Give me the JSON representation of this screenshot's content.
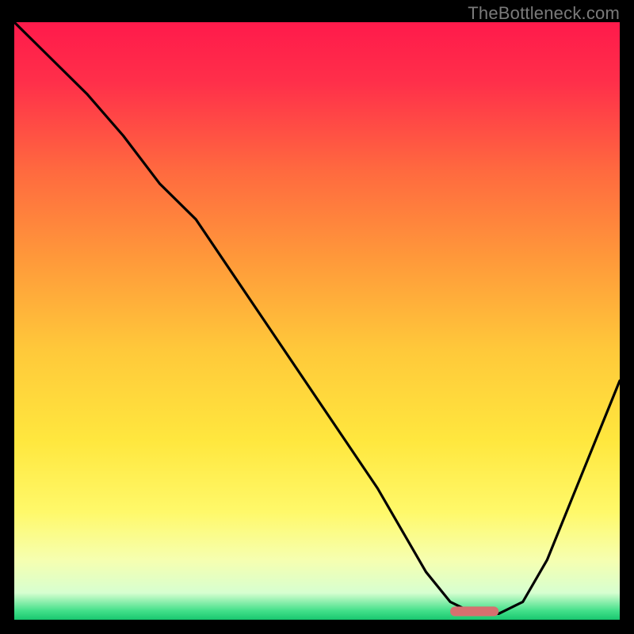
{
  "watermark": "TheBottleneck.com",
  "chart_data": {
    "type": "line",
    "title": "",
    "xlabel": "",
    "ylabel": "",
    "xlim": [
      0,
      100
    ],
    "ylim": [
      0,
      100
    ],
    "grid": false,
    "legend": false,
    "gradient_stops": [
      {
        "offset": 0.0,
        "color": "#ff1a4b"
      },
      {
        "offset": 0.1,
        "color": "#ff2f4a"
      },
      {
        "offset": 0.25,
        "color": "#ff6a3f"
      },
      {
        "offset": 0.4,
        "color": "#ff9a3a"
      },
      {
        "offset": 0.55,
        "color": "#ffc93a"
      },
      {
        "offset": 0.7,
        "color": "#ffe73e"
      },
      {
        "offset": 0.82,
        "color": "#fff96a"
      },
      {
        "offset": 0.9,
        "color": "#f6ffb0"
      },
      {
        "offset": 0.955,
        "color": "#d7ffd0"
      },
      {
        "offset": 0.985,
        "color": "#43e08a"
      },
      {
        "offset": 1.0,
        "color": "#19c76f"
      }
    ],
    "series": [
      {
        "name": "bottleneck-curve",
        "color": "#000000",
        "x": [
          0,
          6,
          12,
          18,
          24,
          30,
          36,
          42,
          48,
          54,
          60,
          64,
          68,
          72,
          76,
          80,
          84,
          88,
          92,
          96,
          100
        ],
        "values": [
          100,
          94,
          88,
          81,
          73,
          67,
          58,
          49,
          40,
          31,
          22,
          15,
          8,
          3,
          1,
          1,
          3,
          10,
          20,
          30,
          40
        ]
      }
    ],
    "marker": {
      "name": "optimal-range",
      "color": "#d6706f",
      "x_start": 72,
      "x_end": 80,
      "y": 0.6,
      "height": 1.6
    }
  }
}
